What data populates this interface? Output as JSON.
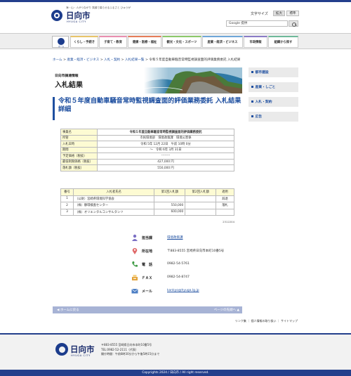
{
  "header": {
    "catchphrase": "海・山・人がつながり 笑顔で暮らせるふるさと ひゅうが",
    "logo_name": "日向市",
    "logo_roman": "HYUGA CITY",
    "font_size_label": "文字サイズ",
    "font_size_large": "拡大",
    "font_size_standard": "標準",
    "search_placeholder": "Google 提供"
  },
  "nav": {
    "home": "ホーム",
    "items": [
      {
        "label": "くらし・手続き",
        "color": "#e8c46a"
      },
      {
        "label": "子育て・教育",
        "color": "#e98fb0"
      },
      {
        "label": "健康・医療・福祉",
        "color": "#e57d59"
      },
      {
        "label": "観光・文化・スポーツ",
        "color": "#8cc86a"
      },
      {
        "label": "産業・経済・ビジネス",
        "color": "#6fa6d8"
      },
      {
        "label": "市政情報",
        "color": "#8a7cc6"
      },
      {
        "label": "組織から探す",
        "color": "#6fb99a"
      }
    ]
  },
  "breadcrumb": {
    "items": [
      "ホーム",
      "産業・経済・ビジネス",
      "入札・契約",
      "入札結果一覧"
    ],
    "current": "令和５年度自動車騒音常時監視調査面的評価業務委託 入札結果",
    "sep": " > "
  },
  "banner": {
    "small": "日向市調達情報",
    "big": "入札結果"
  },
  "page_title": "令和５年度自動車騒音常時監視調査面的評価業務委託 入札結果 詳細",
  "sidebar": {
    "items": [
      "都市建設",
      "産業・しごと",
      "入札・契約",
      "広告"
    ]
  },
  "info_table": {
    "rows": [
      {
        "key": "事業名",
        "value": "令和５年度自動車騒音常時監視調査面的評価業務委託",
        "bold": true
      },
      {
        "key": "所管",
        "value": "市民環境部　環境政策課　環境公害係"
      },
      {
        "key": "入札日時",
        "value": "令和 5年 12月 22日　午前 10時 0分"
      },
      {
        "key": "期間",
        "value": "～　令和 6年 3月 31日"
      },
      {
        "key": "予定価格（税抜）",
        "value": "--------"
      },
      {
        "key": "最低制限価格（税抜）",
        "value": "427,000 円"
      },
      {
        "key": "落札額（税抜）",
        "value": "550,000 円"
      }
    ]
  },
  "bid_table": {
    "headers": [
      "番号",
      "入札者氏名",
      "第1回入札額",
      "第2回入札額",
      "適用"
    ],
    "rows": [
      {
        "no": "1",
        "name": "（公財）宮崎県環境科学協会",
        "r1": "",
        "r2": "",
        "note": "辞退"
      },
      {
        "no": "2",
        "name": "（株）静環検査センター",
        "r1": "550,000",
        "r2": "",
        "note": "落札"
      },
      {
        "no": "3",
        "name": "（株）オリエンタルコンサルタンツ",
        "r1": "600,000",
        "r2": "",
        "note": ""
      }
    ]
  },
  "record_code": "2312204",
  "contact": {
    "rows": [
      {
        "label": "担当課",
        "value": "環境政策課",
        "link": true
      },
      {
        "label": "所在地",
        "value": "〒883-8555 宮崎県日向市本町10番5号",
        "link": false
      },
      {
        "label": "電　話",
        "value": "0982-54-5761",
        "link": false
      },
      {
        "label": "ＦＡＸ",
        "value": "0982-54-8747",
        "link": false
      },
      {
        "label": "メール",
        "value": "kankyo@hyuga.lg.jp",
        "link": true
      }
    ]
  },
  "bottom_bar": {
    "left": "ホームに戻る",
    "right": "ページの先頭へ"
  },
  "footer_links": "リンク集 ｜ 個人情報の取り扱い ｜ サイトマップ",
  "footer": {
    "logo_name": "日向市",
    "logo_roman": "HYUGA CITY",
    "address": "〒883-8555 宮崎県日向市本町10番5号",
    "tel": "TEL:0982-52-2111（代表）",
    "hours": "開庁時間：午前8時30分から午後5時15分まで",
    "copyright": "Copyrights 2024 / 日向市 / All right reserved."
  },
  "colors": {
    "brand": "#233f8c",
    "link": "#1e4fa0",
    "table_key_bg": "#fdfbd3"
  }
}
